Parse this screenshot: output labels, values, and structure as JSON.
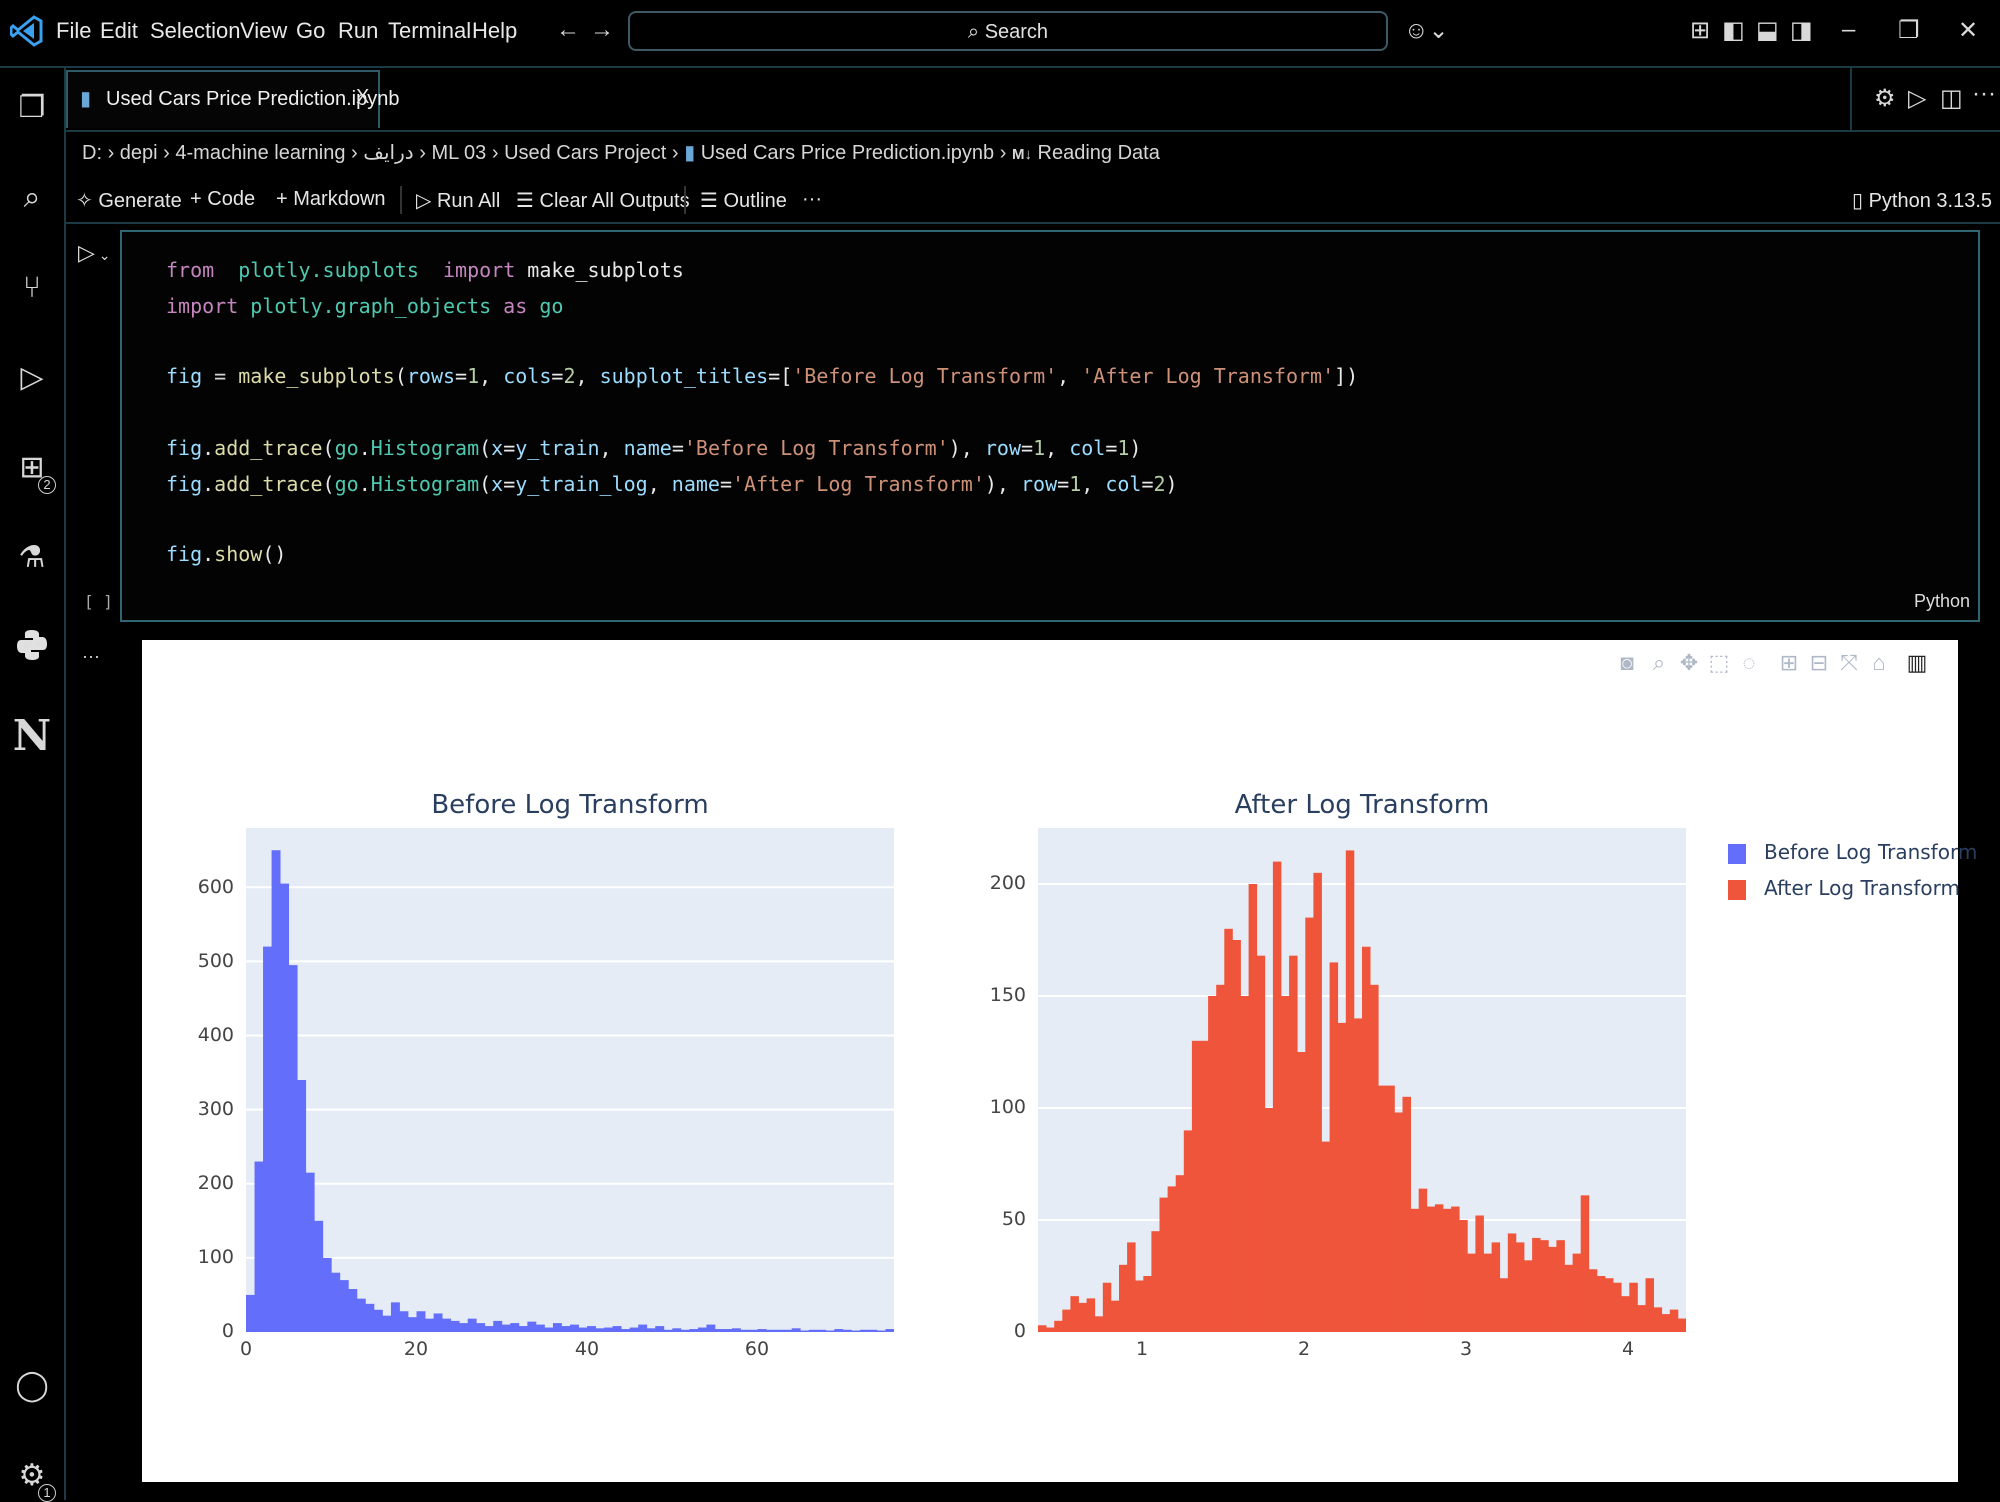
{
  "titlebar": {
    "menu": [
      "File",
      "Edit",
      "Selection",
      "View",
      "Go",
      "Run",
      "Terminal",
      "Help"
    ],
    "search_label": "Search"
  },
  "tab": {
    "label": "Used Cars Price Prediction.ipynb",
    "close": "X"
  },
  "breadcrumb": [
    "D:",
    "depi",
    "4-machine learning",
    "درايف",
    "ML 03",
    "Used Cars Project",
    "Used Cars Price Prediction.ipynb",
    "Reading Data"
  ],
  "toolbar": {
    "generate": "Generate",
    "code": "Code",
    "markdown": "Markdown",
    "run_all": "Run All",
    "clear_outputs": "Clear All Outputs",
    "outline": "Outline",
    "more": "···",
    "kernel": "Python 3.13.5"
  },
  "cell": {
    "language": "Python",
    "brackets": "[ ]",
    "output_more": "···"
  },
  "activity_badges": {
    "extensions": "2",
    "settings": "1"
  },
  "plot": {
    "titles": [
      "Before Log Transform",
      "After Log Transform"
    ],
    "legend": [
      {
        "name": "Before Log Transform",
        "color": "#636efa"
      },
      {
        "name": "After Log Transform",
        "color": "#ef553b"
      }
    ],
    "left_yticks": [
      "0",
      "100",
      "200",
      "300",
      "400",
      "500",
      "600"
    ],
    "left_xticks": [
      "0",
      "20",
      "40",
      "60"
    ],
    "right_yticks": [
      "0",
      "50",
      "100",
      "150",
      "200"
    ],
    "right_xticks": [
      "1",
      "2",
      "3",
      "4"
    ]
  },
  "chart_data": [
    {
      "type": "bar",
      "title": "Before Log Transform",
      "color": "#636efa",
      "xlim": [
        0,
        76
      ],
      "ylim": [
        0,
        680
      ],
      "bin_start": 0,
      "bin_width": 1,
      "values": [
        50,
        230,
        520,
        650,
        605,
        495,
        340,
        215,
        150,
        100,
        80,
        70,
        58,
        45,
        38,
        30,
        22,
        40,
        28,
        20,
        28,
        18,
        25,
        18,
        15,
        12,
        18,
        12,
        8,
        15,
        10,
        12,
        8,
        14,
        10,
        6,
        12,
        8,
        10,
        6,
        8,
        5,
        6,
        8,
        4,
        6,
        10,
        5,
        8,
        3,
        5,
        3,
        4,
        6,
        10,
        4,
        4,
        5,
        3,
        3,
        4,
        3,
        3,
        3,
        5,
        2,
        3,
        3,
        2,
        4,
        3,
        2,
        3,
        3,
        2,
        4
      ]
    },
    {
      "type": "bar",
      "title": "After Log Transform",
      "color": "#ef553b",
      "xlim": [
        0.35,
        4.35
      ],
      "ylim": [
        0,
        225
      ],
      "bin_start": 0.35,
      "bin_width": 0.05,
      "values": [
        3,
        2,
        5,
        10,
        16,
        13,
        15,
        7,
        22,
        14,
        30,
        40,
        23,
        25,
        45,
        60,
        65,
        70,
        90,
        130,
        130,
        150,
        155,
        180,
        175,
        150,
        200,
        168,
        100,
        210,
        150,
        168,
        125,
        185,
        205,
        85,
        165,
        138,
        215,
        140,
        172,
        155,
        110,
        110,
        98,
        105,
        55,
        64,
        56,
        57,
        55,
        56,
        50,
        35,
        52,
        35,
        40,
        24,
        44,
        40,
        32,
        42,
        41,
        38,
        41,
        30,
        35,
        61,
        28,
        25,
        24,
        22,
        16,
        22,
        12,
        24,
        11,
        8,
        10,
        6,
        5,
        4,
        7
      ]
    }
  ]
}
